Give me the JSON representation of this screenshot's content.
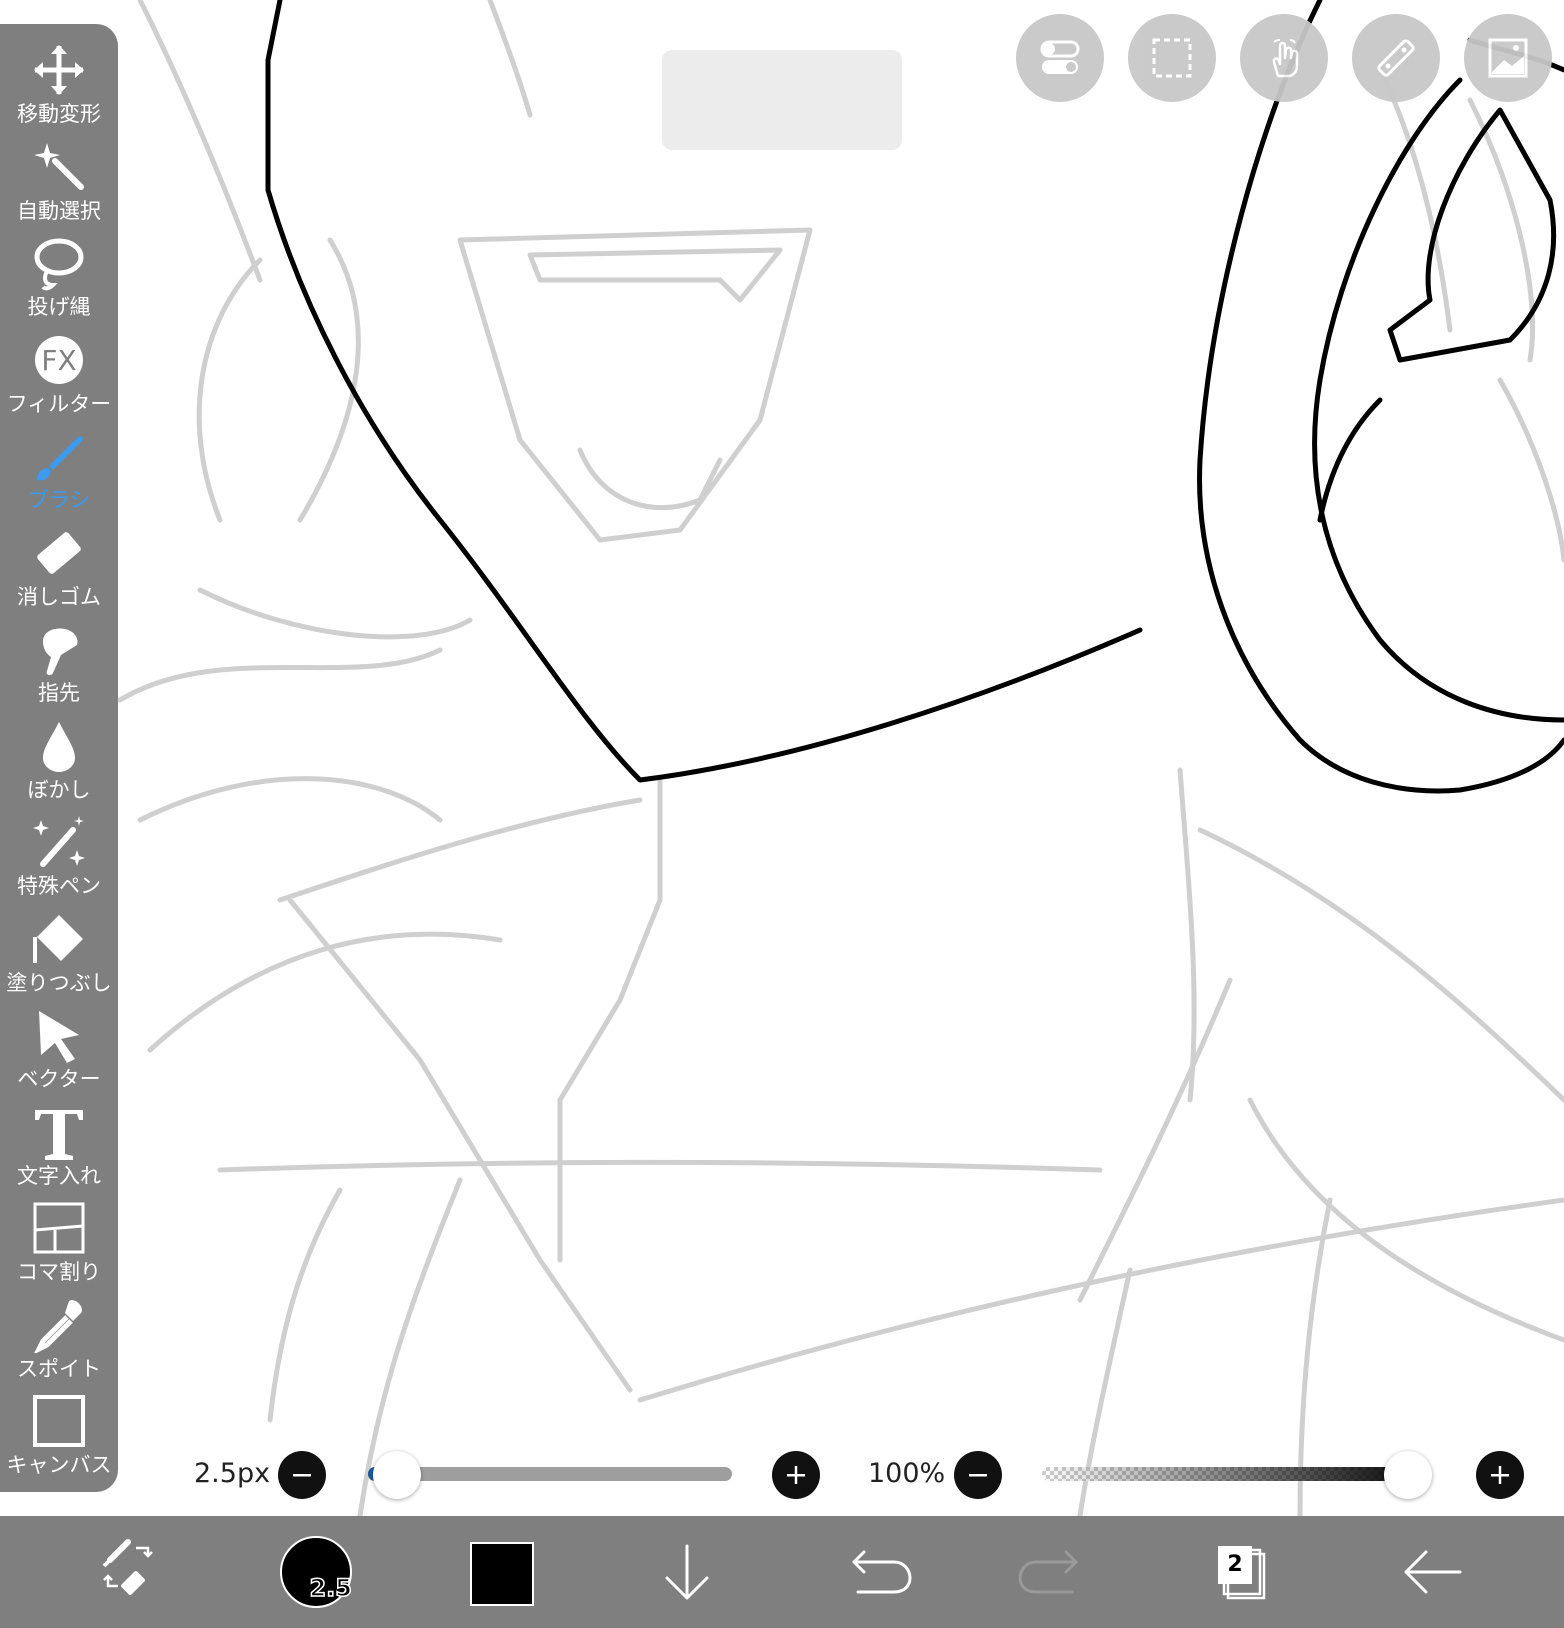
{
  "tools": [
    {
      "id": "move",
      "label": "移動変形",
      "icon": "move-arrows-icon"
    },
    {
      "id": "magic-wand",
      "label": "自動選択",
      "icon": "magic-wand-icon"
    },
    {
      "id": "lasso",
      "label": "投げ縄",
      "icon": "lasso-icon"
    },
    {
      "id": "filter",
      "label": "フィルター",
      "icon": "fx-icon",
      "glyph": "FX"
    },
    {
      "id": "brush",
      "label": "ブラシ",
      "icon": "brush-icon",
      "active": true
    },
    {
      "id": "eraser",
      "label": "消しゴム",
      "icon": "eraser-icon"
    },
    {
      "id": "smudge",
      "label": "指先",
      "icon": "finger-icon"
    },
    {
      "id": "blur",
      "label": "ぼかし",
      "icon": "drop-icon"
    },
    {
      "id": "special-pen",
      "label": "特殊ペン",
      "icon": "sparkle-pen-icon"
    },
    {
      "id": "fill",
      "label": "塗りつぶし",
      "icon": "paint-bucket-icon"
    },
    {
      "id": "vector",
      "label": "ベクター",
      "icon": "cursor-arrow-icon"
    },
    {
      "id": "text",
      "label": "文字入れ",
      "icon": "text-t-icon",
      "glyph": "T"
    },
    {
      "id": "frame-divider",
      "label": "コマ割り",
      "icon": "panel-divider-icon"
    },
    {
      "id": "eyedropper",
      "label": "スポイト",
      "icon": "eyedropper-icon"
    },
    {
      "id": "canvas",
      "label": "キャンバス",
      "icon": "canvas-square-icon"
    }
  ],
  "top_buttons": [
    "toggle-icon",
    "selection-rect-icon",
    "touch-hand-icon",
    "ruler-icon",
    "image-layer-icon"
  ],
  "brush_size": {
    "label": "2.5px",
    "fraction": 0.03
  },
  "opacity": {
    "label": "100%",
    "fraction": 1.0
  },
  "bottom_bar": {
    "brush_size_value": "2.5",
    "layer_count": "2",
    "primary_color": "#000000"
  },
  "colors": {
    "toolbar": "#7f7f7f",
    "active": "#3a9bf0",
    "sketch": "#c8c8c8",
    "line": "#000000"
  }
}
